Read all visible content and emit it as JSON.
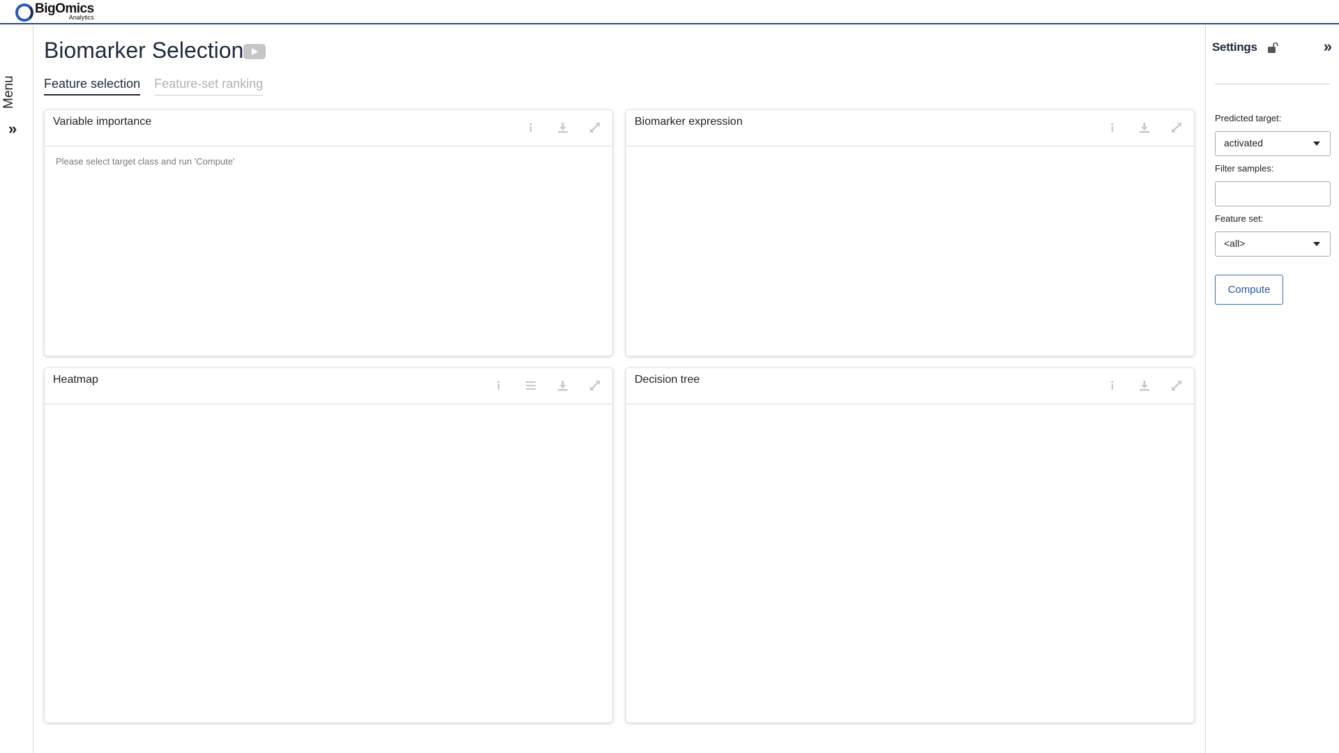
{
  "header": {
    "logo_main": "BigOmics",
    "logo_sub": "Analytics"
  },
  "left_rail": {
    "menu_label": "Menu",
    "expand_icon": "double-chevron-right-icon"
  },
  "page": {
    "title": "Biomarker Selection",
    "video_icon": "play-video-icon",
    "tabs": [
      {
        "label": "Feature selection",
        "active": true
      },
      {
        "label": "Feature-set ranking",
        "active": false
      }
    ]
  },
  "cards": {
    "variable_importance": {
      "title": "Variable importance",
      "message": "Please select target class and run 'Compute'",
      "icons": [
        "info-icon",
        "download-icon",
        "expand-icon"
      ]
    },
    "biomarker_expression": {
      "title": "Biomarker expression",
      "icons": [
        "info-icon",
        "download-icon",
        "expand-icon"
      ]
    },
    "heatmap": {
      "title": "Heatmap",
      "icons": [
        "info-icon",
        "menu-icon",
        "download-icon",
        "expand-icon"
      ]
    },
    "decision_tree": {
      "title": "Decision tree",
      "icons": [
        "info-icon",
        "download-icon",
        "expand-icon"
      ]
    }
  },
  "settings": {
    "title": "Settings",
    "lock_icon": "unlocked-icon",
    "collapse_icon": "double-chevron-right-icon",
    "predicted_target": {
      "label": "Predicted target:",
      "value": "activated"
    },
    "filter_samples": {
      "label": "Filter samples:",
      "value": ""
    },
    "feature_set": {
      "label": "Feature set:",
      "value": "<all>"
    },
    "compute_label": "Compute"
  },
  "colors": {
    "header_border": "#2a4a7f",
    "accent_button": "#3a6fb0",
    "icon_muted": "#c9c9c9"
  }
}
